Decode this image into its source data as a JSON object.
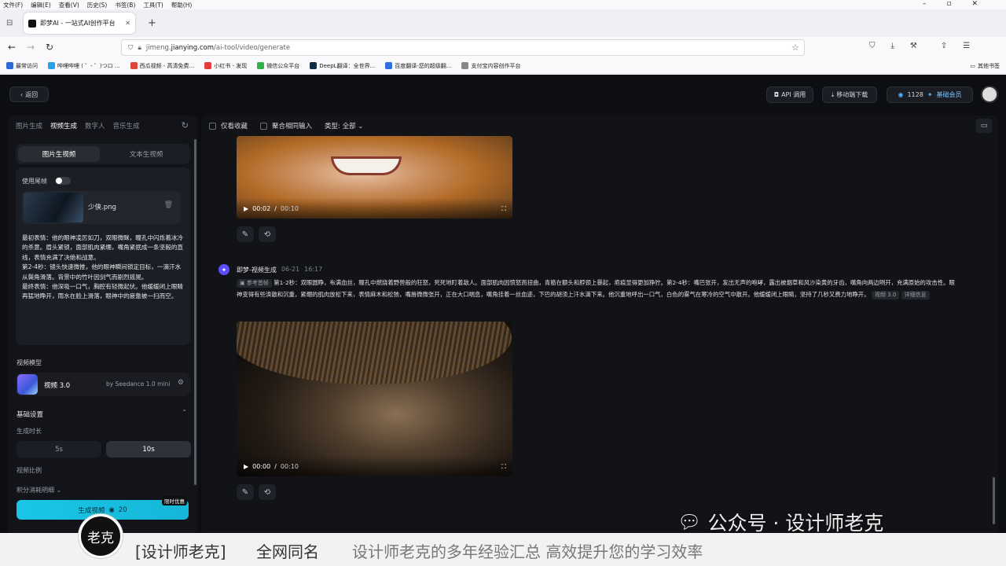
{
  "browser": {
    "menu": [
      "文件(F)",
      "编辑(E)",
      "查看(V)",
      "历史(S)",
      "书签(B)",
      "工具(T)",
      "帮助(H)"
    ],
    "tab_title": "即梦AI - 一站式AI创作平台",
    "url_prefix": "jimeng.",
    "url_domain": "jianying.com",
    "url_path": "/ai-tool/video/generate",
    "bookmarks": [
      "最常访问",
      "哔哩哔哩 ( ゜- ゜)つロ ...",
      "西瓜视频 - 高清免费...",
      "小红书 - 发现",
      "微信公众平台",
      "DeepL翻译：全世界...",
      "百度翻译-您的超级翻...",
      "支付宝内容创作平台"
    ],
    "bookmark_colors": [
      "#2b6ad4",
      "#2aa0e8",
      "#e0443a",
      "#e23c3c",
      "#2fb24a",
      "#0f2b46",
      "#2f6fe0",
      "#888888"
    ],
    "other_bookmarks": "其他书签"
  },
  "header": {
    "back": "返回",
    "api": "API 调用",
    "mobile": "移动端下载",
    "points": "1128",
    "member": "基础会员"
  },
  "left": {
    "tabs": [
      "图片生成",
      "视频生成",
      "数字人",
      "音乐生成"
    ],
    "mode_img": "图片生视频",
    "mode_text": "文本生视频",
    "last_frame": "使用尾帧",
    "file_name": "少侠.png",
    "prompt": "最初表情：他的眼神凌厉如刀，双眼微眯，瞳孔中闪烁着冰冷的杀意。眉头紧锁，面部肌肉紧绷，嘴角紧抿成一条坚毅的直线，表情充满了决绝和战意。\n第2-4秒：镜头快速微推，他的眼神瞬间锁定目标，一滴汗水从鬓角滑落。背景中的竹叶因剑气而剧烈摇晃。\n最终表情：他深吸一口气，胸腔有轻微起伏。他缓缓闭上眼睛再猛地睁开，雨水在脸上滑落，眼神中的疲惫被一扫而空。",
    "model_label": "视频模型",
    "model_name": "视频 3.0",
    "model_by": "by Seedance 1.0 mini",
    "basic": "基础设置",
    "duration_label": "生成时长",
    "d5": "5s",
    "d10": "10s",
    "ratio_label": "视频比例",
    "points_detail": "积分消耗明细",
    "gen_button": "生成视频",
    "gen_cost": "20",
    "limited": "限时优惠"
  },
  "right": {
    "only_fav": "仅看收藏",
    "merge": "聚合相同输入",
    "type_filter": "类型: 全部",
    "v1_time": "00:02",
    "v1_total": "00:10",
    "msg_name": "即梦-视频生成",
    "msg_date": "06-21",
    "msg_time": "16:17",
    "ref_tag": "参考首帧",
    "msg_text": "第1-2秒：双眼圆睁，布满血丝，瞳孔中燃烧着野兽般的狂怒，死死地盯着敌人。面部肌肉因愤怒而扭曲，青筋在额头和脖颈上暴起，疤痕显得更加狰狞。第2-4秒：嘴巴张开，发出无声的咆哮，露出被烟草和风沙染黄的牙齿，嘴角向两边咧开，充满原始的攻击性。眼神变得有些涣散和沉重，紧绷的肌肉放松下来，表情麻木和松弛，嘴唇微微张开，正在大口喘息，嘴角挂着一丝血迹，下巴的胡须上汗水滴下来。他沉重地呼出一口气，白色的雾气在寒冷的空气中散开。他缓缓闭上眼睛，坚持了几秒又费力地睁开。",
    "model_tag": "视频 3.0",
    "detail_tag": "详细信息",
    "v2_time": "00:00",
    "v2_total": "00:10"
  },
  "overlay": {
    "watermark": "公众号 · 设计师老克",
    "brand": "[设计师老克]",
    "same_name": "全网同名",
    "slogan": "设计师老克的多年经验汇总  高效提升您的学习效率",
    "logo_char": "老克"
  }
}
